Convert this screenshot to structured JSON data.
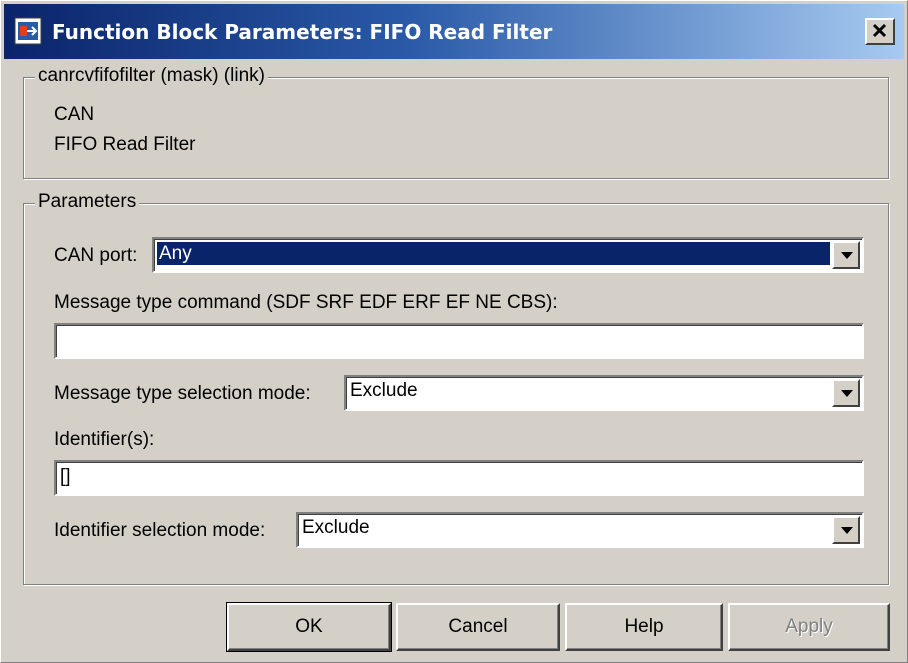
{
  "window": {
    "title": "Function Block Parameters: FIFO Read Filter"
  },
  "mask_group": {
    "legend": "canrcvfifofilter (mask) (link)",
    "lines": [
      "CAN",
      "FIFO Read Filter"
    ]
  },
  "parameters": {
    "legend": "Parameters",
    "can_port": {
      "label": "CAN port:",
      "value": "Any"
    },
    "message_type_command": {
      "label": "Message type command (SDF SRF EDF ERF EF NE CBS):",
      "value": ""
    },
    "message_type_mode": {
      "label": "Message type selection mode:",
      "value": "Exclude"
    },
    "identifiers": {
      "label": "Identifier(s):",
      "value": "[]"
    },
    "identifier_mode": {
      "label": "Identifier selection mode:",
      "value": "Exclude"
    }
  },
  "buttons": {
    "ok": "OK",
    "cancel": "Cancel",
    "help": "Help",
    "apply": "Apply"
  },
  "colors": {
    "title_start": "#0a246a",
    "title_end": "#a6caf0",
    "selection": "#0a246a",
    "face": "#d4d0c8"
  },
  "icons": {
    "app": "simulink-block-icon",
    "close": "close-x-icon",
    "dropdown": "chevron-down-icon"
  }
}
